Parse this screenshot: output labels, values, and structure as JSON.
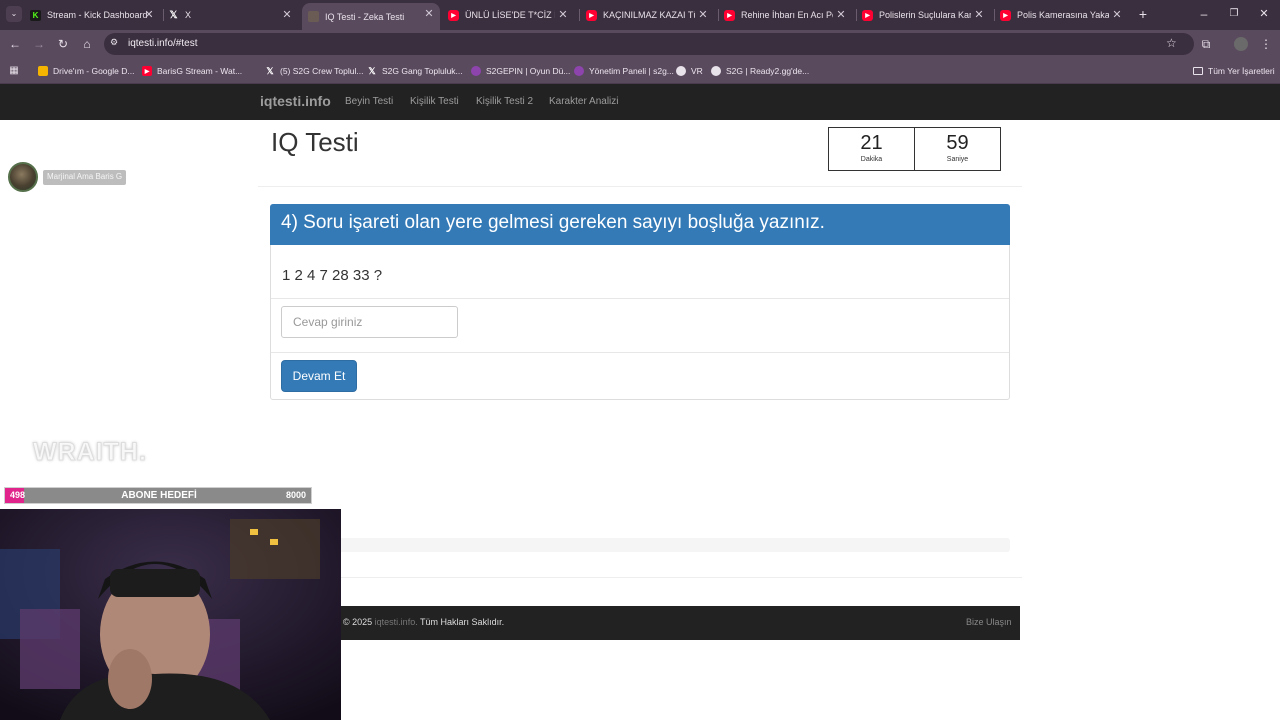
{
  "browser": {
    "tabs": [
      {
        "title": "Stream - Kick Dashboard",
        "icon": "kick-icon"
      },
      {
        "title": "X",
        "icon": "x-icon"
      },
      {
        "title": "IQ Testi - Zeka Testi",
        "icon": "site-icon",
        "active": true
      },
      {
        "title": "ÜNLÜ LİSE'DE T*CİZ İDDİA",
        "icon": "youtube-icon"
      },
      {
        "title": "KAÇINILMAZ KAZAI Türkiye",
        "icon": "youtube-icon"
      },
      {
        "title": "Rehine İhbarı En Acı Polis",
        "icon": "youtube-icon"
      },
      {
        "title": "Polislerin Suçlulara Karşı",
        "icon": "youtube-icon"
      },
      {
        "title": "Polis Kamerasına Yakalanan",
        "icon": "youtube-icon"
      }
    ],
    "url": "iqtesti.info/#test",
    "bookmarks": [
      "Drive'ım - Google D...",
      "BarisG Stream - Wat...",
      "(5) S2G Crew Toplul...",
      "S2G Gang Topluluk...",
      "S2GEPIN | Oyun Dü...",
      "Yönetim Paneli | s2g...",
      "VR",
      "S2G | Ready2.gg'de..."
    ],
    "all_bookmarks": "Tüm Yer İşaretleri"
  },
  "site": {
    "brand": "iqtesti.info",
    "nav": [
      "Beyin Testi",
      "Kişilik Testi",
      "Kişilik Testi 2",
      "Karakter Analizi"
    ]
  },
  "test": {
    "title": "IQ Testi",
    "timer": {
      "minutes": "21",
      "minutes_label": "Dakika",
      "seconds": "59",
      "seconds_label": "Saniye"
    },
    "question": "4) Soru işareti olan yere gelmesi gereken sayıyı boşluğa yazınız.",
    "sequence": "1 2 4 7 28 33 ?",
    "answer_placeholder": "Cevap giriniz",
    "continue_label": "Devam Et",
    "progress_fraction": 0.01
  },
  "footer": {
    "prefix": "© 2025",
    "site": "iqtesti.info.",
    "rights": "Tüm Hakları Saklıdır.",
    "contact": "Bize Ulaşın"
  },
  "overlay": {
    "chat_name": "Marjinal Ama Baris G",
    "wraith": "WRAITH.",
    "sub_goal": {
      "current": "498",
      "label": "ABONE HEDEFİ",
      "target": "8000"
    }
  }
}
